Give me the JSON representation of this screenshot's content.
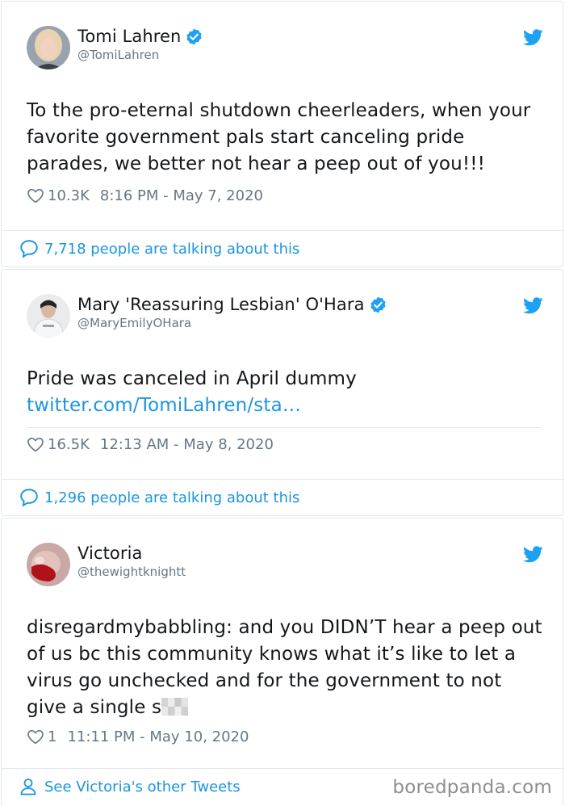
{
  "tweets": [
    {
      "display_name": "Tomi Lahren",
      "handle": "@TomiLahren",
      "verified": true,
      "text": "To the pro-eternal shutdown cheerleaders, when your favorite government pals start canceling pride parades, we better not hear a peep out of you!!!",
      "likes": "10.3K",
      "timestamp": "8:16 PM - May 7, 2020",
      "footer": "7,718 people are talking about this"
    },
    {
      "display_name": "Mary 'Reassuring Lesbian' O'Hara",
      "handle": "@MaryEmilyOHara",
      "verified": true,
      "text": "Pride was canceled in April dummy",
      "link": "twitter.com/TomiLahren/sta…",
      "likes": "16.5K",
      "timestamp": "12:13 AM - May 8, 2020",
      "footer": "1,296 people are talking about this"
    },
    {
      "display_name": "Victoria",
      "handle": "@thewightknightt",
      "verified": false,
      "text": "disregardmybabbling: and you DIDN’T hear a peep out of us bc this community knows what it’s like to let a virus go unchecked and for the government to not give a single s",
      "likes": "1",
      "timestamp": "11:11 PM - May 10, 2020",
      "footer": "See Victoria's other Tweets"
    }
  ],
  "watermark": "boredpanda.com",
  "colors": {
    "link": "#1b95e0",
    "muted": "#657786",
    "border": "#e1e8ed",
    "verified": "#1da1f2"
  },
  "icons": [
    "verified-badge-icon",
    "twitter-bird-icon",
    "heart-icon",
    "speech-bubble-icon",
    "person-icon"
  ]
}
